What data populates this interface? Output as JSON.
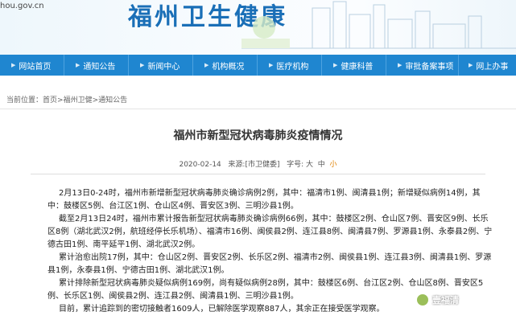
{
  "header": {
    "url_fragment": "hou.gov.cn",
    "site_title": "福州卫生健康"
  },
  "nav": [
    {
      "label": "网站首页"
    },
    {
      "label": "通知公告"
    },
    {
      "label": "新闻中心"
    },
    {
      "label": "机构概况"
    },
    {
      "label": "医疗机构"
    },
    {
      "label": "健康科普"
    },
    {
      "label": "审批备案事项"
    },
    {
      "label": "网上办事"
    }
  ],
  "breadcrumb": {
    "prefix": "当前位置：",
    "home": "首页",
    "sep": ">",
    "section": "福州卫健",
    "current": "通知公告"
  },
  "article": {
    "title": "福州市新型冠状病毒肺炎疫情情况",
    "date": "2020-02-14",
    "source_label": "来源:",
    "source": "[市卫健委]",
    "font_label": "字号:",
    "size_large": "大",
    "size_medium": "中",
    "size_small": "小",
    "paragraphs": [
      "2月13日0-24时，福州市新增新型冠状病毒肺炎确诊病例2例，其中：福清市1例、闽清县1例；新增疑似病例14例，其中：鼓楼区5例、台江区1例、仓山区4例、晋安区3例、三明沙县1例。",
      "截至2月13日24时，福州市累计报告新型冠状病毒肺炎确诊病例66例，其中：鼓楼区2例、仓山区7例、晋安区9例、长乐区8例（湖北武汉2例，航班经停长乐机场）、福清市16例、闽侯县2例、连江县8例、闽清县7例、罗源县1例、永泰县2例、宁德古田1例、南平延平1例、湖北武汉2例。",
      "累计治愈出院17例，其中：仓山区2例、晋安区2例、长乐区2例、福清市2例、闽侯县1例、连江县3例、闽清县1例、罗源县1例，永泰县1例、宁德古田1例、湖北武汉1例。",
      "累计排除新型冠状病毒肺炎疑似病例169例，尚有疑似病例28例，其中：鼓楼区6例、台江区2例、仓山区8例、晋安区5例、长乐区1例、闽侯县2例、连江县2例、闽清县1例、三明沙县1例。",
      "目前，累计追踪到的密切接触者1609人，已解除医学观察887人，其余正在接受医学观察。"
    ]
  },
  "watermark": {
    "text": "壹福清"
  },
  "colors": {
    "nav_bg": "#1f86d0",
    "title_blue": "#1a6fb7",
    "accent_orange": "#e08000"
  }
}
